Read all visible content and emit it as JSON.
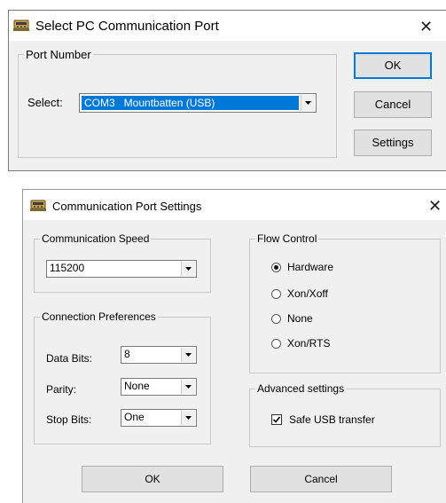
{
  "dialog1": {
    "title": "Select PC Communication Port",
    "close": "✕",
    "icon": "app-icon",
    "port_group_label": "Port Number",
    "select_label": "Select:",
    "port_value": "COM3   Mountbatten (USB)",
    "ok_label": "OK",
    "cancel_label": "Cancel",
    "settings_label": "Settings"
  },
  "dialog2": {
    "title": "Communication Port Settings",
    "close": "✕",
    "icon": "app-icon",
    "speed_group_label": "Communication Speed",
    "speed_value": "115200",
    "conn_group_label": "Connection Preferences",
    "data_bits_label": "Data Bits:",
    "data_bits_value": "8",
    "parity_label": "Parity:",
    "parity_value": "None",
    "stop_bits_label": "Stop Bits:",
    "stop_bits_value": "One",
    "flow_group_label": "Flow Control",
    "flow_options": [
      {
        "label": "Hardware",
        "selected": true
      },
      {
        "label": "Xon/Xoff",
        "selected": false
      },
      {
        "label": "None",
        "selected": false
      },
      {
        "label": "Xon/RTS",
        "selected": false
      }
    ],
    "adv_group_label": "Advanced settings",
    "safe_usb_label": "Safe USB transfer",
    "safe_usb_checked": true,
    "ok_label": "OK",
    "cancel_label": "Cancel"
  },
  "colors": {
    "accent": "#0078d7",
    "dialog_bg": "#f0f0f0",
    "button_bg": "#e1e1e1"
  }
}
